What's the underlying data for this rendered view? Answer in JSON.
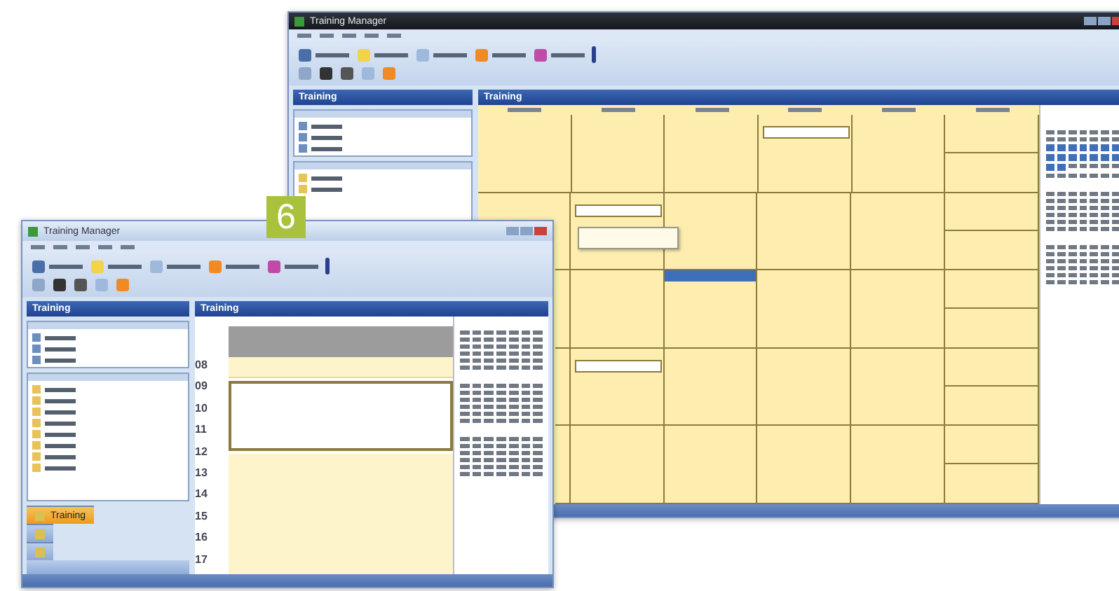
{
  "badge": "6",
  "back_window": {
    "title": "Training Manager",
    "left_header": "Training",
    "main_header": "Training",
    "weeks": [
      {
        "days": [
          {
            "selected": false,
            "has_event": false
          },
          {
            "selected": false,
            "has_event": false
          },
          {
            "selected": false,
            "has_event": false
          },
          {
            "selected": false,
            "has_event": true
          },
          {
            "selected": false,
            "has_event": false
          },
          {
            "selected": false,
            "has_event": false
          }
        ]
      },
      {
        "days": [
          {
            "selected": false,
            "has_event": false
          },
          {
            "selected": false,
            "has_event": true
          },
          {
            "selected": false,
            "has_event": false
          },
          {
            "selected": false,
            "has_event": false
          },
          {
            "selected": false,
            "has_event": false
          },
          {
            "selected": false,
            "has_event": false
          }
        ]
      },
      {
        "days": [
          {
            "selected": false,
            "has_event": false
          },
          {
            "selected": false,
            "has_event": false
          },
          {
            "selected": true,
            "has_event": false
          },
          {
            "selected": false,
            "has_event": false
          },
          {
            "selected": false,
            "has_event": false
          },
          {
            "selected": false,
            "has_event": false
          }
        ]
      },
      {
        "days": [
          {
            "selected": false,
            "has_event": false
          },
          {
            "selected": false,
            "has_event": true
          },
          {
            "selected": false,
            "has_event": false
          },
          {
            "selected": false,
            "has_event": false
          },
          {
            "selected": false,
            "has_event": false
          },
          {
            "selected": false,
            "has_event": false
          }
        ]
      },
      {
        "days": [
          {
            "selected": false,
            "has_event": false
          },
          {
            "selected": false,
            "has_event": false
          },
          {
            "selected": false,
            "has_event": false
          },
          {
            "selected": false,
            "has_event": false
          },
          {
            "selected": false,
            "has_event": false
          },
          {
            "selected": false,
            "has_event": false
          }
        ]
      }
    ]
  },
  "front_window": {
    "title": "Training Manager",
    "left_header": "Training",
    "main_header": "Training",
    "nav_buttons": [
      {
        "label": "Training",
        "selected": true
      },
      {
        "selected": false
      },
      {
        "selected": false
      }
    ],
    "hours": [
      "08",
      "09",
      "10",
      "11",
      "12",
      "13",
      "14",
      "15",
      "16",
      "17"
    ]
  }
}
